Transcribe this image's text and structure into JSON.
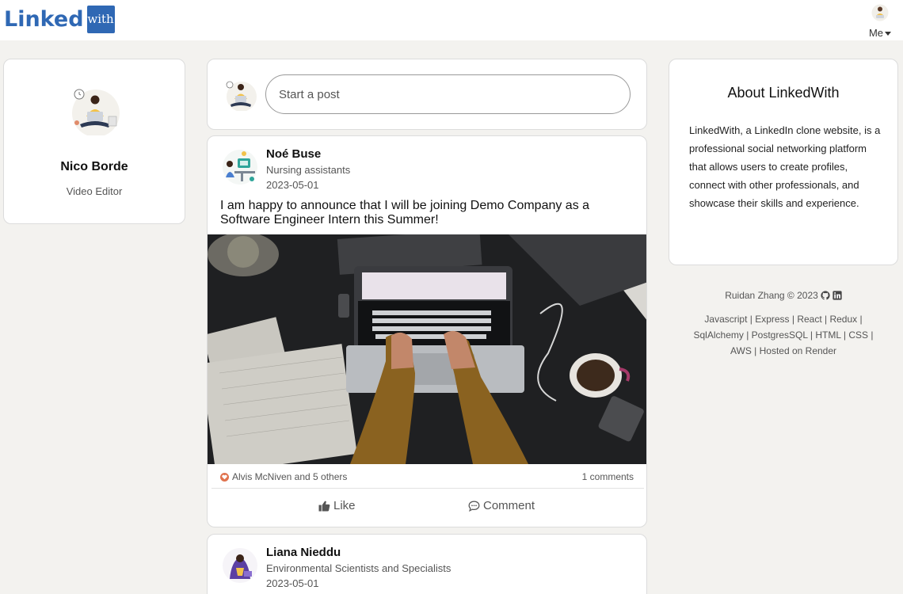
{
  "header": {
    "logo_text": "Linked",
    "logo_box_text": "with",
    "me_label": "Me"
  },
  "profile": {
    "name": "Nico Borde",
    "title": "Video Editor"
  },
  "composer": {
    "placeholder": "Start a post"
  },
  "posts": [
    {
      "author": "Noé Buse",
      "role": "Nursing assistants",
      "date": "2023-05-01",
      "text": "I am happy to announce that I will be joining Demo Company as a Software Engineer Intern this Summer!",
      "reactions": "Alvis McNiven and 5 others",
      "comments": "1 comments",
      "like_label": "Like",
      "comment_label": "Comment"
    },
    {
      "author": "Liana Nieddu",
      "role": "Environmental Scientists and Specialists",
      "date": "2023-05-01"
    }
  ],
  "about": {
    "title": "About LinkedWith",
    "body": "LinkedWith, a LinkedIn clone website, is a professional social networking platform that allows users to create profiles, connect with other professionals, and showcase their skills and experience."
  },
  "footer": {
    "credit": "Ruidan Zhang © 2023",
    "tech": "Javascript | Express | React | Redux | SqlAlchemy | PostgresSQL | HTML | CSS | AWS | Hosted on Render"
  },
  "colors": {
    "brand": "#2f68b4",
    "background": "#f3f2ef",
    "heart": "#e0734e"
  },
  "icons": [
    "github-icon",
    "linkedin-icon",
    "heart-icon",
    "thumbs-up-icon",
    "comment-icon",
    "chevron-down-icon"
  ]
}
